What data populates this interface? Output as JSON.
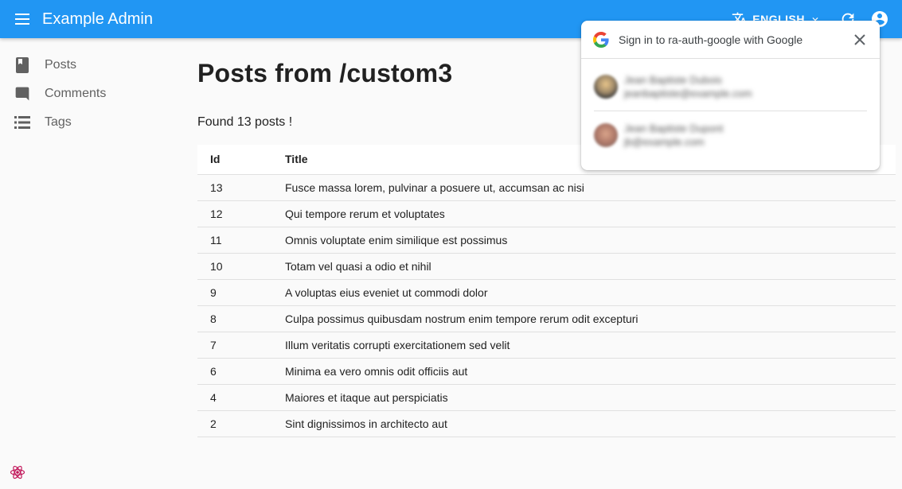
{
  "appbar": {
    "title": "Example Admin",
    "language": "ENGLISH",
    "icons": [
      "menu-icon",
      "translate-icon",
      "chevron-down-icon",
      "refresh-icon",
      "account-icon"
    ]
  },
  "sidebar": {
    "items": [
      {
        "label": "Posts",
        "icon": "book-icon"
      },
      {
        "label": "Comments",
        "icon": "comment-icon"
      },
      {
        "label": "Tags",
        "icon": "list-icon"
      }
    ]
  },
  "main": {
    "title": "Posts from /custom3",
    "count_text": "Found 13 posts !",
    "table": {
      "headers": [
        "Id",
        "Title"
      ],
      "rows": [
        {
          "id": "13",
          "title": "Fusce massa lorem, pulvinar a posuere ut, accumsan ac nisi"
        },
        {
          "id": "12",
          "title": "Qui tempore rerum et voluptates"
        },
        {
          "id": "11",
          "title": "Omnis voluptate enim similique est possimus"
        },
        {
          "id": "10",
          "title": "Totam vel quasi a odio et nihil"
        },
        {
          "id": "9",
          "title": "A voluptas eius eveniet ut commodi dolor"
        },
        {
          "id": "8",
          "title": "Culpa possimus quibusdam nostrum enim tempore rerum odit excepturi"
        },
        {
          "id": "7",
          "title": "Illum veritatis corrupti exercitationem sed velit"
        },
        {
          "id": "6",
          "title": "Minima ea vero omnis odit officiis aut"
        },
        {
          "id": "4",
          "title": "Maiores et itaque aut perspiciatis"
        },
        {
          "id": "2",
          "title": "Sint dignissimos in architecto aut"
        }
      ]
    }
  },
  "google_popup": {
    "title": "Sign in to ra-auth-google with Google",
    "accounts": [
      {
        "name": "Jean Baptiste Dubois",
        "email": "jeanbaptiste@example.com"
      },
      {
        "name": "Jean Baptiste Dupont",
        "email": "jb@example.com"
      }
    ]
  },
  "colors": {
    "appbar": "#2196f3",
    "sidebar_text": "#616161",
    "table_header_bg": "#ffffff"
  }
}
